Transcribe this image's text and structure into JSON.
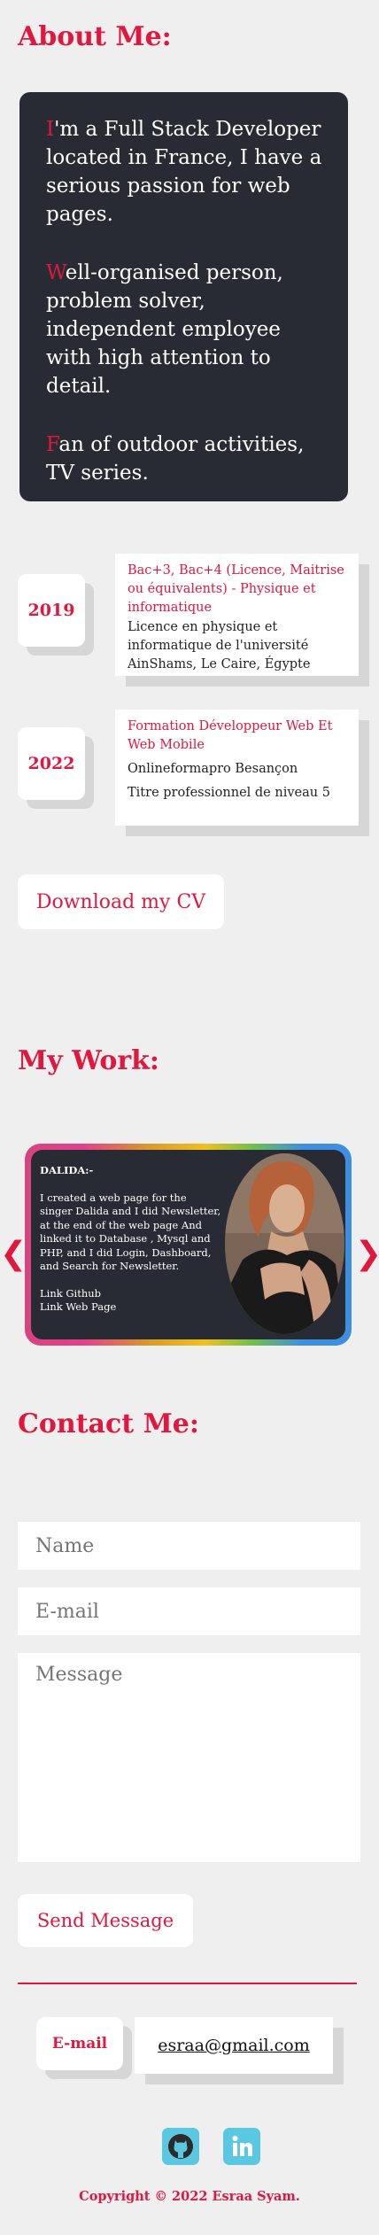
{
  "about": {
    "title": "About Me:",
    "paragraphs": [
      {
        "initial": "I",
        "rest": "'m a Full Stack Developer located in France, I have a serious passion for web pages."
      },
      {
        "initial": "W",
        "rest": "ell-organised person, problem solver, independent employee with high attention to detail."
      },
      {
        "initial": "F",
        "rest": "an of outdoor activities, TV series."
      }
    ]
  },
  "education": [
    {
      "year": "2019",
      "title": "Bac+3, Bac+4 (Licence, Maitrise ou équivalents) - Physique et informatique",
      "lines": [
        "Licence en physique et informatique de l'université AinShams, Le Caire, Égypte"
      ]
    },
    {
      "year": "2022",
      "title": "Formation Développeur Web Et Web Mobile",
      "lines": [
        "Onlineformapro Besançon",
        "Titre professionnel de niveau 5"
      ]
    }
  ],
  "cv_button_label": "Download my CV",
  "work": {
    "title": "My Work:",
    "prev_arrow": "❮",
    "next_arrow": "❯",
    "project": {
      "name": "DALIDA:-",
      "description": "I created a web page for the singer Dalida and I did Newsletter, at the end of the web page And linked it to Database , Mysql and PHP, and I did Login, Dashboard, and Search for Newsletter.",
      "link_github": "Link Github",
      "link_page": "Link Web Page"
    }
  },
  "contact": {
    "title": "Contact Me:",
    "name_placeholder": "Name",
    "email_placeholder": "E-mail",
    "message_placeholder": "Message",
    "send_label": "Send Message",
    "email_label": "E-mail",
    "email_value": "esraa@gmail.com"
  },
  "footer": "Copyright © 2022 Esraa Syam.",
  "colors": {
    "accent": "#e0183f",
    "card_dark": "#282b33",
    "background": "#efefef",
    "social": "#5ac8e0"
  },
  "icons": [
    "github-icon",
    "linkedin-icon",
    "chevron-left-icon",
    "chevron-right-icon"
  ]
}
